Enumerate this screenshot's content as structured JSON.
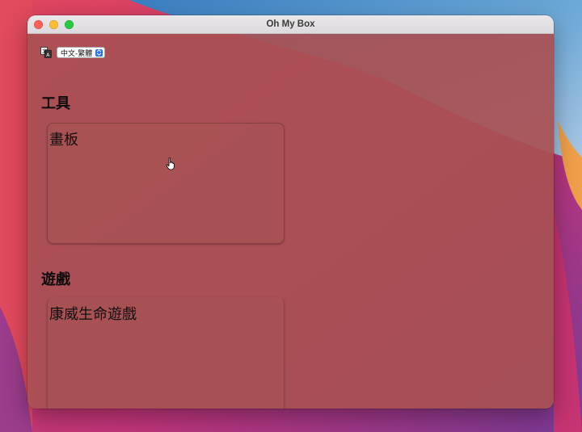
{
  "window": {
    "title": "Oh My Box"
  },
  "language": {
    "selected": "中文-繁體",
    "icon": "language-translate-icon"
  },
  "sections": [
    {
      "title": "工具",
      "items": [
        {
          "label": "畫板"
        }
      ]
    },
    {
      "title": "遊戲",
      "items": [
        {
          "label": "康威生命遊戲"
        }
      ]
    }
  ],
  "colors": {
    "window_tint": "#a85052",
    "select_accent": "#2f73f5",
    "close": "#fe5f57",
    "minimize": "#febc2e",
    "maximize": "#28c840"
  }
}
